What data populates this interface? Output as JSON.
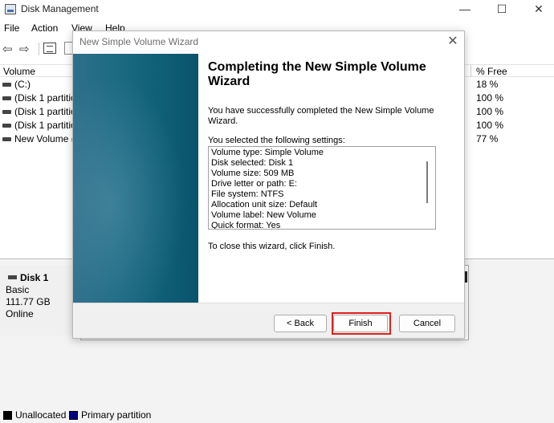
{
  "window": {
    "title": "Disk Management",
    "controls": {
      "minimize": "—",
      "maximize": "☐",
      "close": "✕"
    }
  },
  "menu": [
    "File",
    "Action",
    "View",
    "Help"
  ],
  "toolbar": {
    "back": "⇦",
    "forward": "⇨"
  },
  "volumes": {
    "headers": {
      "volume": "Volume",
      "free": "% Free"
    },
    "rows": [
      {
        "name": "(C:)",
        "free": "18 %"
      },
      {
        "name": "(Disk 1 partition 1)",
        "free": "100 %"
      },
      {
        "name": "(Disk 1 partition 2)",
        "free": "100 %"
      },
      {
        "name": "(Disk 1 partition 3)",
        "free": "100 %"
      },
      {
        "name": "New Volume (E:)",
        "free": "77 %"
      }
    ]
  },
  "disk": {
    "name": "Disk 1",
    "type": "Basic",
    "size": "111.77 GB",
    "status": "Online"
  },
  "legend": [
    {
      "label": "Unallocated",
      "color": "#000000"
    },
    {
      "label": "Primary partition",
      "color": "#00007f"
    }
  ],
  "wizard": {
    "title": "New Simple Volume Wizard",
    "close": "✕",
    "heading": "Completing the New Simple Volume Wizard",
    "intro": "You have successfully completed the New Simple Volume Wizard.",
    "settings_label": "You selected the following settings:",
    "settings": [
      "Volume type: Simple Volume",
      "Disk selected: Disk 1",
      "Volume size: 509 MB",
      "Drive letter or path: E:",
      "File system: NTFS",
      "Allocation unit size: Default",
      "Volume label: New Volume",
      "Quick format: Yes"
    ],
    "close_hint": "To close this wizard, click Finish.",
    "buttons": {
      "back": "< Back",
      "finish": "Finish",
      "cancel": "Cancel"
    },
    "highlight_color": "#e0201b"
  }
}
